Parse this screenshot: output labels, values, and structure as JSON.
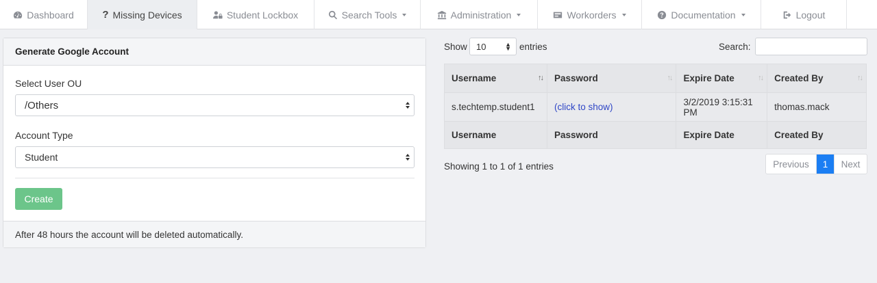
{
  "nav": {
    "items": [
      {
        "label": "Dashboard",
        "icon": "dashboard-icon",
        "caret": false
      },
      {
        "label": "Missing Devices",
        "icon": "question-icon",
        "caret": false,
        "active": true
      },
      {
        "label": "Student Lockbox",
        "icon": "users-lock-icon",
        "caret": false
      },
      {
        "label": "Search Tools",
        "icon": "search-icon",
        "caret": true
      },
      {
        "label": "Administration",
        "icon": "bank-icon",
        "caret": true
      },
      {
        "label": "Workorders",
        "icon": "id-card-icon",
        "caret": true
      },
      {
        "label": "Documentation",
        "icon": "question-circle-icon",
        "caret": true
      },
      {
        "label": "Logout",
        "icon": "sign-out-icon",
        "caret": false
      }
    ]
  },
  "card": {
    "title": "Generate Google Account",
    "ou_label": "Select User OU",
    "ou_value": "/Others",
    "type_label": "Account Type",
    "type_value": "Student",
    "create_label": "Create",
    "footer": "After 48 hours the account will be deleted automatically.",
    "create_color": "#6cc58a"
  },
  "table_controls": {
    "show": "Show",
    "length_value": "10",
    "entries": "entries",
    "search_label": "Search:"
  },
  "table": {
    "columns": [
      "Username",
      "Password",
      "Expire Date",
      "Created By"
    ],
    "rows": [
      [
        "s.techtemp.student1",
        "(click to show)",
        "3/2/2019 3:15:31 PM",
        "thomas.mack"
      ]
    ]
  },
  "footer": {
    "info": "Showing 1 to 1 of 1 entries",
    "prev": "Previous",
    "page": "1",
    "next": "Next",
    "accent": "#1b7ef3"
  }
}
